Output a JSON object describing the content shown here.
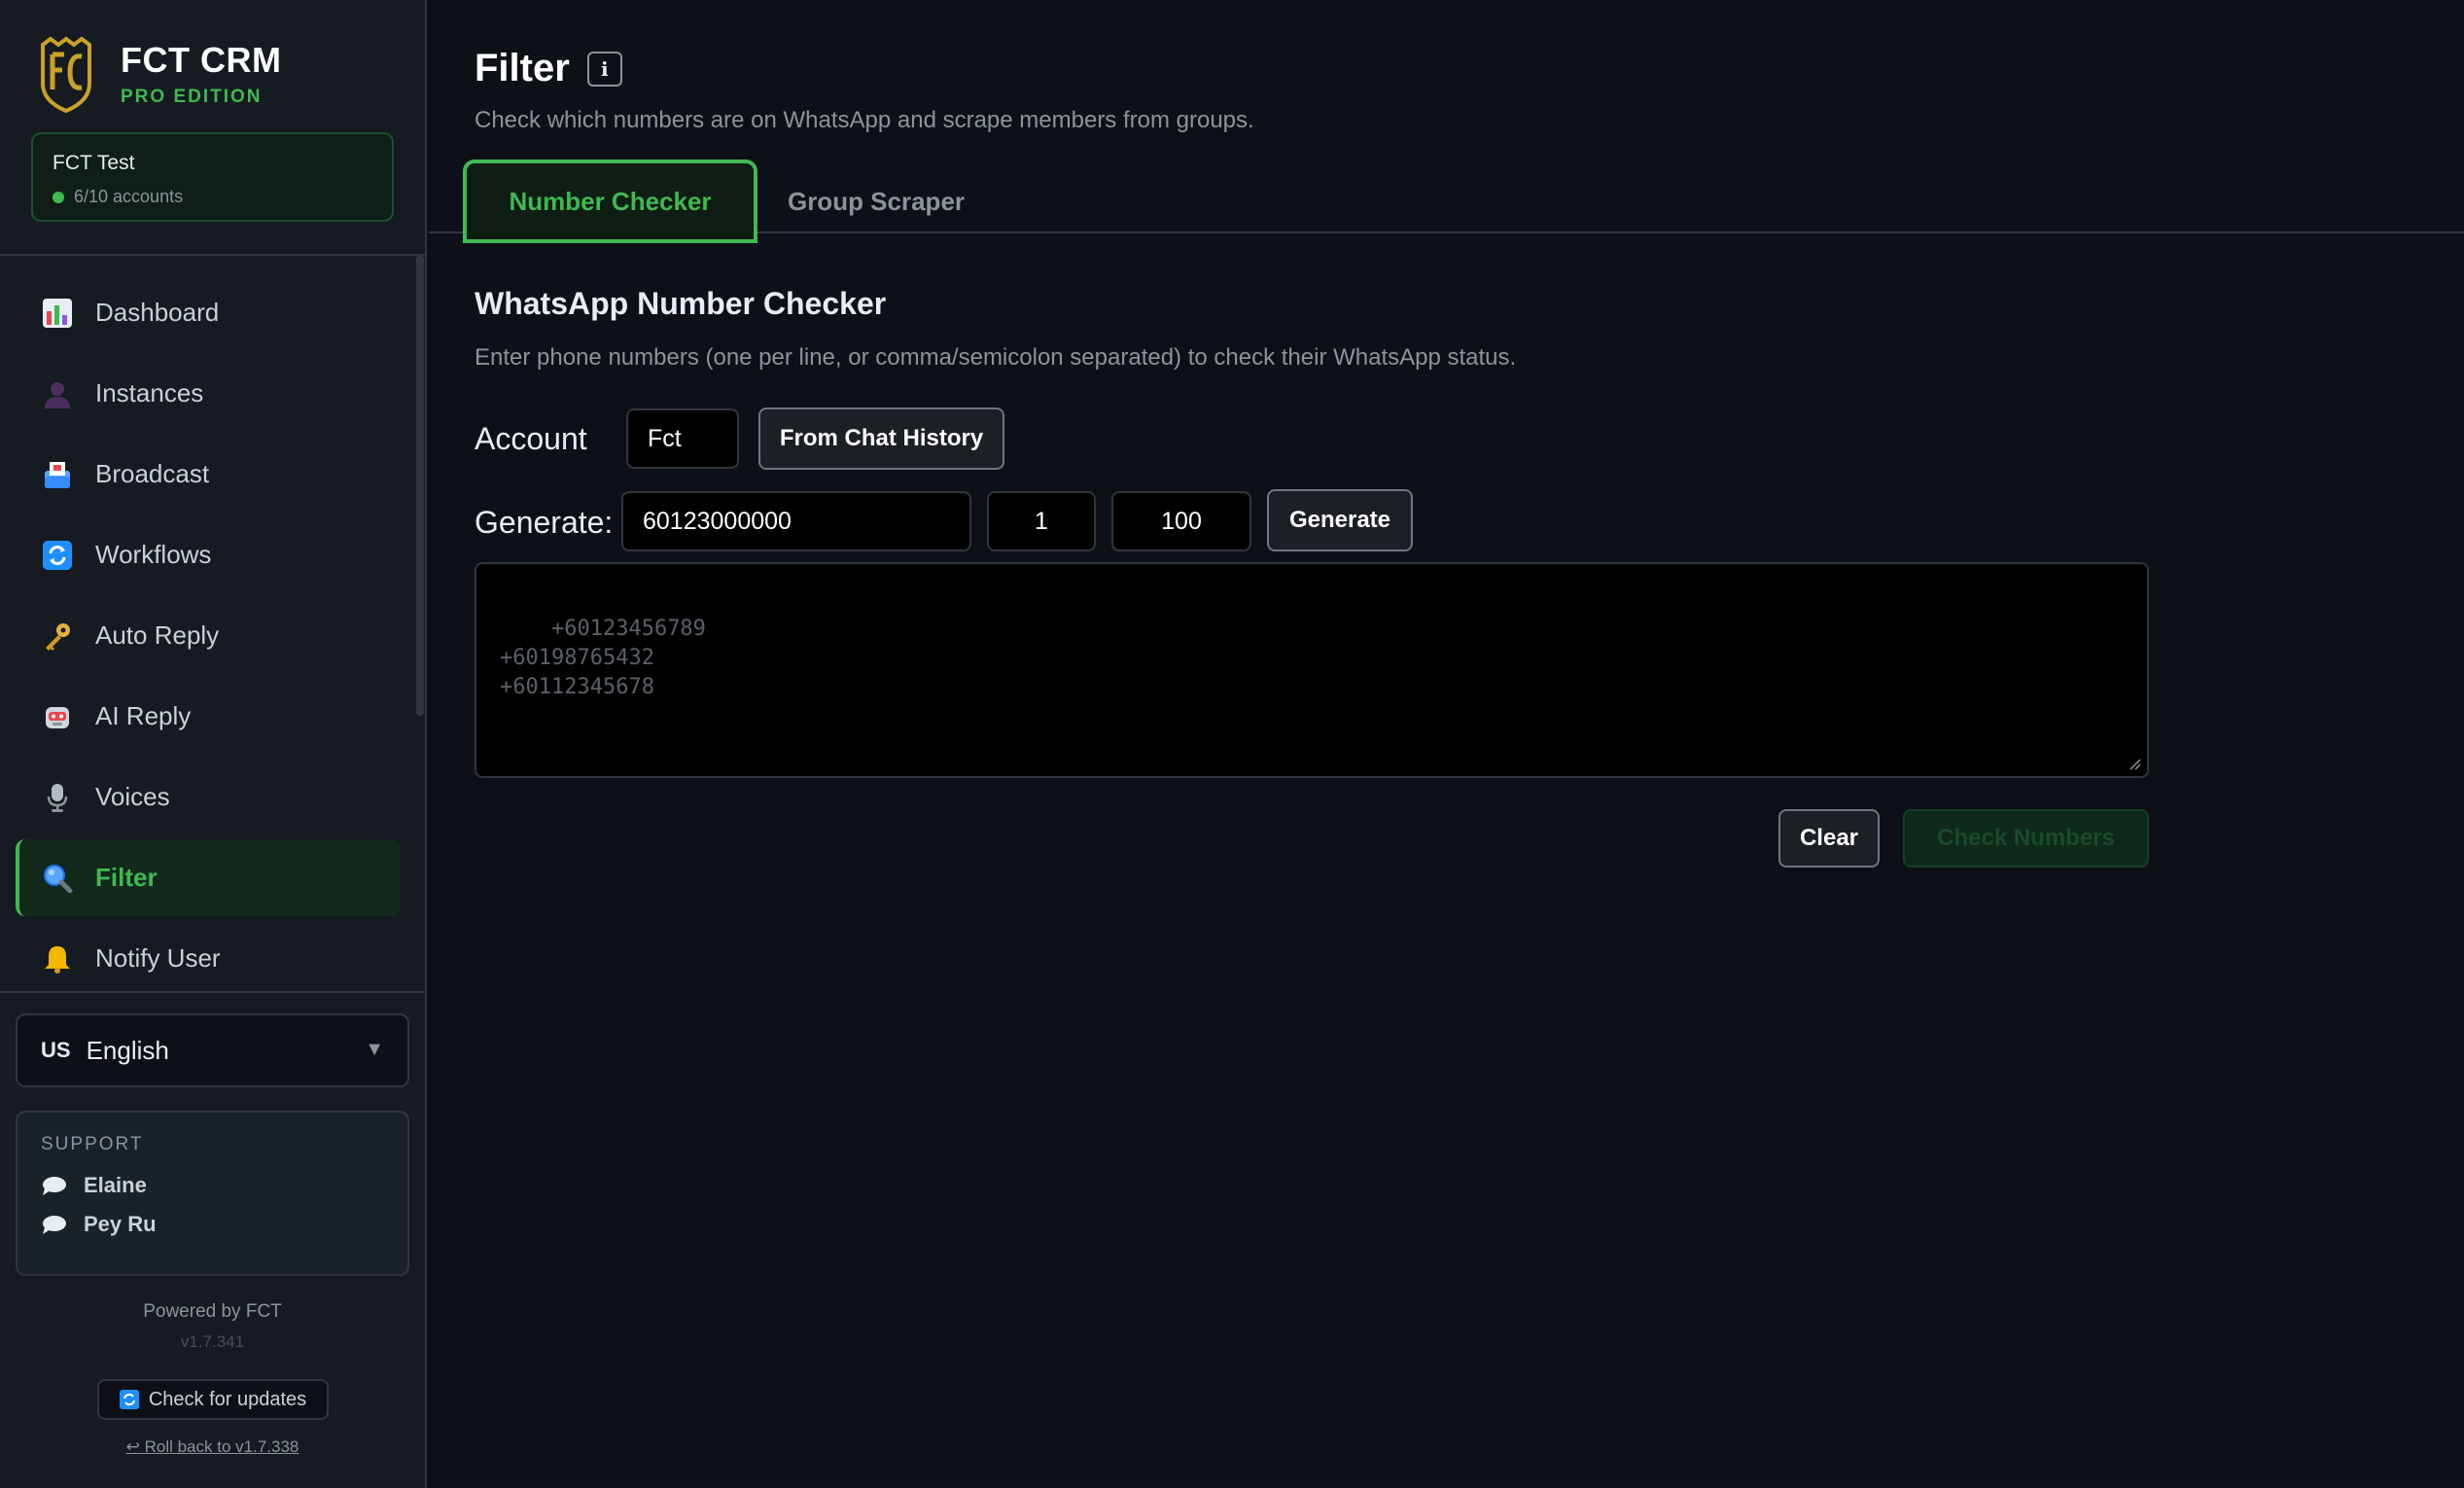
{
  "brand": {
    "title": "FCT CRM",
    "edition": "PRO EDITION"
  },
  "account_card": {
    "name": "FCT Test",
    "status": "6/10 accounts"
  },
  "nav": [
    {
      "label": "Dashboard",
      "icon": "bar-chart-icon"
    },
    {
      "label": "Instances",
      "icon": "user-icon"
    },
    {
      "label": "Broadcast",
      "icon": "inbox-icon"
    },
    {
      "label": "Workflows",
      "icon": "refresh-icon"
    },
    {
      "label": "Auto Reply",
      "icon": "key-icon"
    },
    {
      "label": "AI Reply",
      "icon": "robot-icon"
    },
    {
      "label": "Voices",
      "icon": "microphone-icon"
    },
    {
      "label": "Filter",
      "icon": "magnifier-icon",
      "active": true
    },
    {
      "label": "Notify User",
      "icon": "bell-icon"
    }
  ],
  "language": {
    "flag": "US",
    "label": "English"
  },
  "support": {
    "title": "SUPPORT",
    "contacts": [
      "Elaine",
      "Pey Ru"
    ]
  },
  "footer": {
    "powered": "Powered by FCT",
    "version": "v1.7.341",
    "update": "Check for updates",
    "rollback": "↩ Roll back to v1.7.338"
  },
  "page": {
    "title": "Filter",
    "subtitle": "Check which numbers are on WhatsApp and scrape members from groups."
  },
  "tabs": [
    {
      "label": "Number Checker",
      "active": true
    },
    {
      "label": "Group Scraper",
      "active": false
    }
  ],
  "checker": {
    "title": "WhatsApp Number Checker",
    "description": "Enter phone numbers (one per line, or comma/semicolon separated) to check their WhatsApp status.",
    "account_label": "Account",
    "account_value": "Fct",
    "from_history": "From Chat History",
    "generate_label": "Generate:",
    "generate_prefix": "60123000000",
    "generate_start": "1",
    "generate_count": "100",
    "generate_button": "Generate",
    "numbers_placeholder": "+60123456789\n+60198765432\n+60112345678",
    "clear_button": "Clear",
    "check_button": "Check Numbers"
  },
  "colors": {
    "accent": "#3fb950",
    "background": "#0d1117",
    "sidebar": "#161b22",
    "border": "#30363d"
  }
}
